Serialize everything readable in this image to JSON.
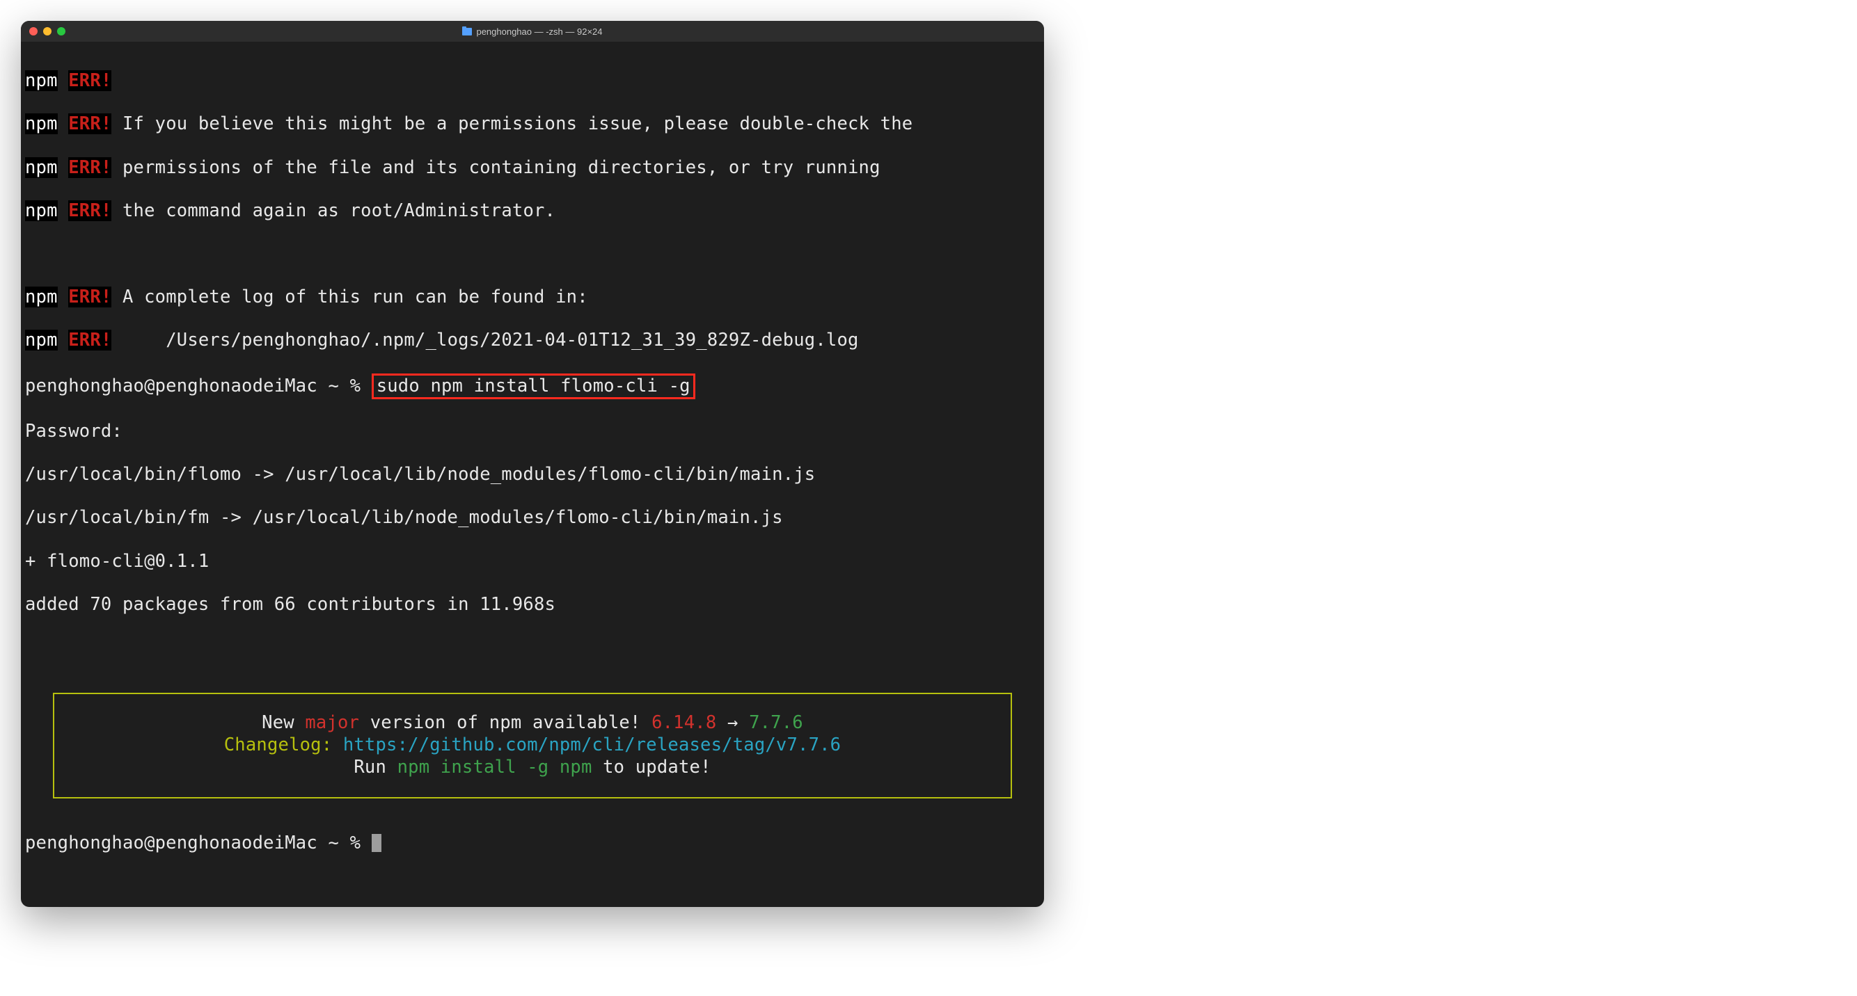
{
  "window": {
    "title": "penghonghao — -zsh — 92×24"
  },
  "err_lines": [
    {
      "npm": "npm",
      "err": "ERR!",
      "text": ""
    },
    {
      "npm": "npm",
      "err": "ERR!",
      "text": " If you believe this might be a permissions issue, please double-check the"
    },
    {
      "npm": "npm",
      "err": "ERR!",
      "text": " permissions of the file and its containing directories, or try running"
    },
    {
      "npm": "npm",
      "err": "ERR!",
      "text": " the command again as root/Administrator."
    }
  ],
  "err_log_lines": [
    {
      "npm": "npm",
      "err": "ERR!",
      "text": " A complete log of this run can be found in:"
    },
    {
      "npm": "npm",
      "err": "ERR!",
      "text": "     /Users/penghonghao/.npm/_logs/2021-04-01T12_31_39_829Z-debug.log"
    }
  ],
  "prompt": {
    "user_host": "penghonghao@penghonaodeiMac ~ % ",
    "command": "sudo npm install flomo-cli -g"
  },
  "output_lines": [
    "Password:",
    "/usr/local/bin/flomo -> /usr/local/lib/node_modules/flomo-cli/bin/main.js",
    "/usr/local/bin/fm -> /usr/local/lib/node_modules/flomo-cli/bin/main.js",
    "+ flomo-cli@0.1.1",
    "added 70 packages from 66 contributors in 11.968s"
  ],
  "notice": {
    "line1_pre": "New ",
    "line1_major": "major",
    "line1_mid": " version of npm available! ",
    "line1_old": "6.14.8",
    "line1_arrow": " → ",
    "line1_new": "7.7.6",
    "line2_pre": "Changelog: ",
    "line2_url": "https://github.com/npm/cli/releases/tag/v7.7.6",
    "line3_pre": "Run ",
    "line3_cmd": "npm install -g npm",
    "line3_post": " to update!"
  },
  "prompt2": {
    "user_host": "penghonghao@penghonaodeiMac ~ % "
  }
}
